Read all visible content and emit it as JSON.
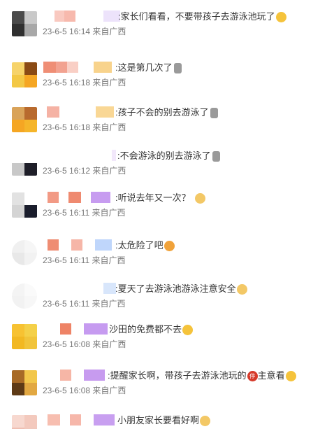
{
  "comments": [
    {
      "text": ":家长们看看，不要带孩子去游泳池玩了",
      "emoji": "worried-face-icon",
      "date": "23-6-5 16:14",
      "location": "来自广西"
    },
    {
      "text": ":这是第几次了",
      "emoji": "microphone-icon",
      "date": "23-6-5 16:18",
      "location": "来自广西"
    },
    {
      "text": ":孩子不会的别去游泳了",
      "emoji": "microphone-icon",
      "date": "23-6-5 16:18",
      "location": "来自广西"
    },
    {
      "text": ":不会游泳的别去游泳了",
      "emoji": "microphone-icon",
      "date": "23-6-5 16:12",
      "location": "来自广西"
    },
    {
      "text": ":听说去年又一次？",
      "emoji": "cat-face-icon",
      "date": "23-6-5 16:11",
      "location": "来自广西"
    },
    {
      "text": ":太危险了吧",
      "emoji": "scared-face-icon",
      "date": "23-6-5 16:11",
      "location": "来自广西"
    },
    {
      "text": ":夏天了去游泳池游泳注意安全",
      "emoji": "cat-face-icon",
      "date": "23-6-5 16:11",
      "location": "来自广西"
    },
    {
      "text": "沙田的免费都不去",
      "emoji": "laughing-face-icon",
      "date": "23-6-5 16:08",
      "location": "来自广西"
    },
    {
      "text": ":提醒家长啊，带孩子去游泳池玩的",
      "text2": "主意看",
      "emoji_mid": "stop-sign-icon",
      "emoji": "worried-face-icon",
      "date": "23-6-5 16:08",
      "location": "来自广西"
    },
    {
      "text": "小朋友家长要看好啊",
      "emoji": "cat-face-icon",
      "date": "",
      "location": ""
    }
  ],
  "icons": {
    "stop_glyph": "停"
  }
}
